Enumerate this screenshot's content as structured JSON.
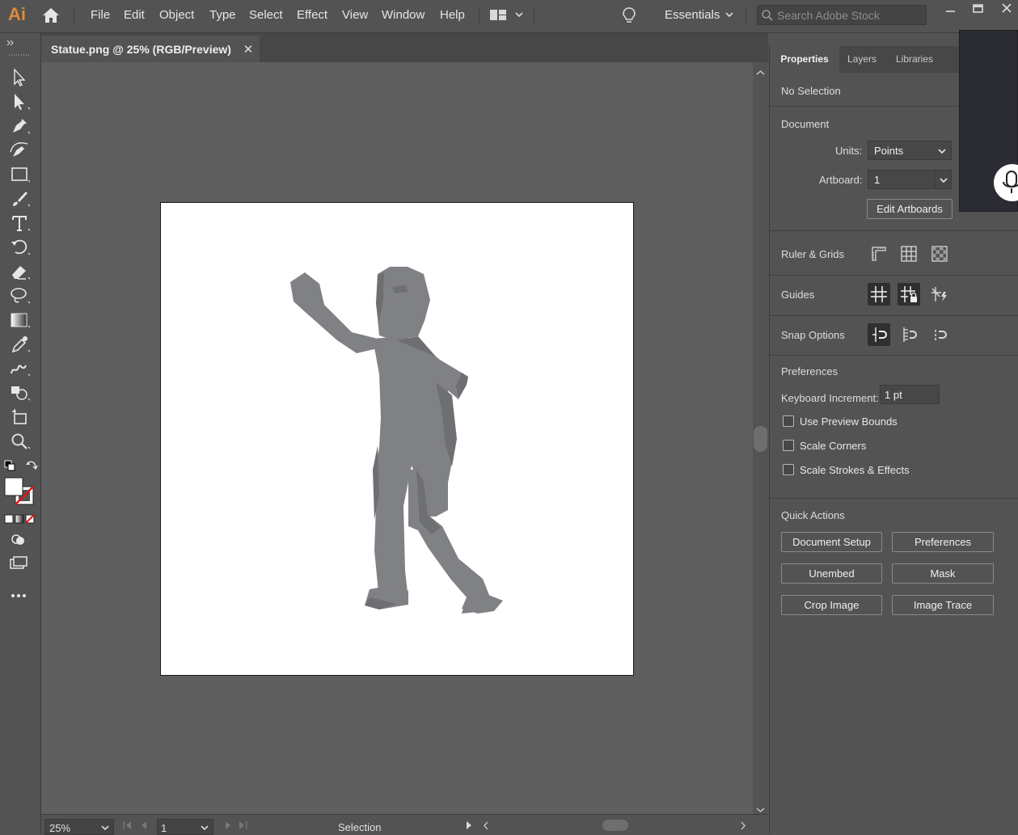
{
  "app": {
    "logo": "Ai",
    "logo_color": "#E08A3A"
  },
  "menu": {
    "items": [
      "File",
      "Edit",
      "Object",
      "Type",
      "Select",
      "Effect",
      "View",
      "Window",
      "Help"
    ],
    "workspace": "Essentials",
    "search_placeholder": "Search Adobe Stock"
  },
  "document": {
    "tab_title": "Statue.png @ 25% (RGB/Preview)",
    "close_glyph": "✕"
  },
  "status": {
    "zoom": "25%",
    "artboard": "1",
    "mode": "Selection"
  },
  "panel": {
    "tabs": [
      "Properties",
      "Layers",
      "Libraries"
    ],
    "active_tab": "Properties",
    "selection": "No Selection",
    "document_heading": "Document",
    "units_label": "Units:",
    "units_value": "Points",
    "artboard_label": "Artboard:",
    "artboard_value": "1",
    "edit_artboards": "Edit Artboards",
    "ruler_grids": "Ruler & Grids",
    "guides": "Guides",
    "snap_options": "Snap Options",
    "preferences_heading": "Preferences",
    "keyboard_increment_label": "Keyboard Increment:",
    "keyboard_increment_value": "1 pt",
    "checkboxes": {
      "use_preview_bounds": {
        "label": "Use Preview Bounds",
        "checked": false
      },
      "scale_corners": {
        "label": "Scale Corners",
        "checked": false
      },
      "scale_strokes": {
        "label": "Scale Strokes & Effects",
        "checked": false
      }
    },
    "quick_actions_heading": "Quick Actions",
    "quick_actions": [
      "Document Setup",
      "Preferences",
      "Unembed",
      "Mask",
      "Crop Image",
      "Image Trace"
    ]
  },
  "icons": {
    "toolbar": [
      "selection-tool",
      "direct-selection-tool",
      "pen-tool",
      "curvature-tool",
      "rectangle-tool",
      "paintbrush-tool",
      "type-tool",
      "rotate-tool",
      "eraser-tool",
      "lasso-tool",
      "gradient-tool",
      "eyedropper-tool",
      "blend-tool",
      "shape-builder-tool",
      "artboard-tool",
      "zoom-tool"
    ],
    "window": [
      "minimize-icon",
      "restore-icon",
      "close-icon"
    ]
  },
  "colors": {
    "ui_bg": "#535353",
    "canvas_bg": "#5F5F5F",
    "artboard": "#FFFFFF",
    "figure": "#808184",
    "figure_shadow": "#6E6F72"
  }
}
